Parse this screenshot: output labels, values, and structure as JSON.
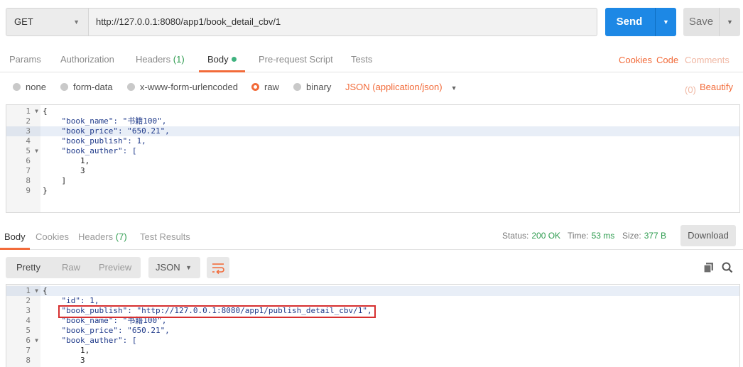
{
  "request": {
    "method": "GET",
    "url": "http://127.0.0.1:8080/app1/book_detail_cbv/1",
    "send_label": "Send",
    "save_label": "Save"
  },
  "request_tabs": {
    "params": "Params",
    "authorization": "Authorization",
    "headers": "Headers",
    "headers_count": "(1)",
    "body": "Body",
    "pre_request": "Pre-request Script",
    "tests": "Tests",
    "cookies": "Cookies",
    "code": "Code",
    "comments": "Comments (0)"
  },
  "body_types": {
    "none": "none",
    "form_data": "form-data",
    "urlencoded": "x-www-form-urlencoded",
    "raw": "raw",
    "binary": "binary",
    "selected": "raw",
    "content_type": "JSON (application/json)",
    "beautify": "Beautify"
  },
  "request_body_lines": [
    {
      "n": "1",
      "fold": true,
      "text": "{"
    },
    {
      "n": "2",
      "fold": false,
      "text": "    \"book_name\": \"书籍100\","
    },
    {
      "n": "3",
      "fold": false,
      "text": "    \"book_price\": \"650.21\",",
      "highlight": true
    },
    {
      "n": "4",
      "fold": false,
      "text": "    \"book_publish\": 1,"
    },
    {
      "n": "5",
      "fold": true,
      "text": "    \"book_auther\": ["
    },
    {
      "n": "6",
      "fold": false,
      "text": "        1,"
    },
    {
      "n": "7",
      "fold": false,
      "text": "        3"
    },
    {
      "n": "8",
      "fold": false,
      "text": "    ]"
    },
    {
      "n": "9",
      "fold": false,
      "text": "}"
    }
  ],
  "response_tabs": {
    "body": "Body",
    "cookies": "Cookies",
    "headers": "Headers",
    "headers_count": "(7)",
    "test_results": "Test Results"
  },
  "response_status": {
    "status_label": "Status:",
    "status_value": "200 OK",
    "time_label": "Time:",
    "time_value": "53 ms",
    "size_label": "Size:",
    "size_value": "377 B",
    "download": "Download"
  },
  "response_view": {
    "pretty": "Pretty",
    "raw": "Raw",
    "preview": "Preview",
    "format": "JSON"
  },
  "response_body_lines": [
    {
      "n": "1",
      "fold": true,
      "text": "{",
      "highlight": true
    },
    {
      "n": "2",
      "fold": false,
      "text": "    \"id\": 1,"
    },
    {
      "n": "3",
      "fold": false,
      "text": "    \"book_publish\": \"http://127.0.0.1:8080/app1/publish_detail_cbv/1\","
    },
    {
      "n": "4",
      "fold": false,
      "text": "    \"book_name\": \"书籍100\","
    },
    {
      "n": "5",
      "fold": false,
      "text": "    \"book_price\": \"650.21\","
    },
    {
      "n": "6",
      "fold": true,
      "text": "    \"book_auther\": ["
    },
    {
      "n": "7",
      "fold": false,
      "text": "        1,"
    },
    {
      "n": "8",
      "fold": false,
      "text": "        3"
    }
  ],
  "colors": {
    "accent": "#f26b3a",
    "send_blue": "#1d88e5",
    "status_green": "#2e9c4f",
    "highlight_red": "#d62f2f"
  }
}
